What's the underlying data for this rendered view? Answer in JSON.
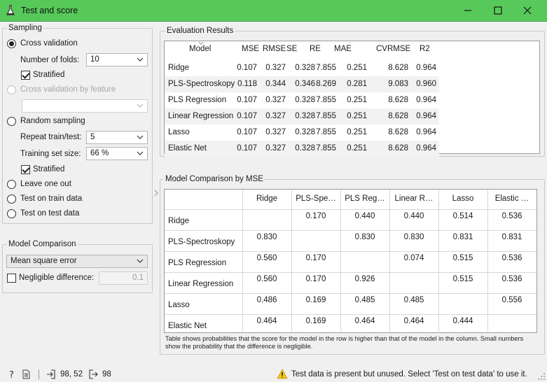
{
  "window": {
    "title": "Test and score"
  },
  "sampling": {
    "title": "Sampling",
    "cross_validation": "Cross validation",
    "folds_label": "Number of folds:",
    "folds_value": "10",
    "stratified": "Stratified",
    "cv_by_feature": "Cross validation by feature",
    "random_sampling": "Random sampling",
    "repeat_label": "Repeat train/test:",
    "repeat_value": "5",
    "train_size_label": "Training set size:",
    "train_size_value": "66 %",
    "stratified2": "Stratified",
    "leave_one_out": "Leave one out",
    "test_on_train": "Test on train data",
    "test_on_test": "Test on test data"
  },
  "model_comparison": {
    "title": "Model Comparison",
    "metric": "Mean square error",
    "negligible_label": "Negligible difference:",
    "negligible_value": "0.1"
  },
  "evaluation": {
    "title": "Evaluation Results",
    "headers": [
      "Model",
      "MSE",
      "RMSE",
      "SE",
      "RE",
      "MAE",
      "CVRMSE",
      "R2"
    ],
    "rows": [
      [
        "Ridge",
        "0.107",
        "0.327",
        "0.328",
        "7.855",
        "0.251",
        "8.628",
        "0.964"
      ],
      [
        "PLS-Spectroskopy",
        "0.118",
        "0.344",
        "0.346",
        "8.269",
        "0.281",
        "9.083",
        "0.960"
      ],
      [
        "PLS Regression",
        "0.107",
        "0.327",
        "0.328",
        "7.855",
        "0.251",
        "8.628",
        "0.964"
      ],
      [
        "Linear Regression",
        "0.107",
        "0.327",
        "0.328",
        "7.855",
        "0.251",
        "8.628",
        "0.964"
      ],
      [
        "Lasso",
        "0.107",
        "0.327",
        "0.328",
        "7.855",
        "0.251",
        "8.628",
        "0.964"
      ],
      [
        "Elastic Net",
        "0.107",
        "0.327",
        "0.328",
        "7.855",
        "0.251",
        "8.628",
        "0.964"
      ]
    ]
  },
  "comparison": {
    "title": "Model Comparison by MSE",
    "col_headers": [
      "Ridge",
      "PLS-Spe…",
      "PLS Reg…",
      "Linear R…",
      "Lasso",
      "Elastic …"
    ],
    "rows": [
      {
        "label": "Ridge",
        "values": [
          "",
          "0.170",
          "0.440",
          "0.440",
          "0.514",
          "0.536"
        ]
      },
      {
        "label": "PLS-Spectroskopy",
        "values": [
          "0.830",
          "",
          "0.830",
          "0.830",
          "0.831",
          "0.831"
        ]
      },
      {
        "label": "PLS Regression",
        "values": [
          "0.560",
          "0.170",
          "",
          "0.074",
          "0.515",
          "0.536"
        ]
      },
      {
        "label": "Linear Regression",
        "values": [
          "0.560",
          "0.170",
          "0.926",
          "",
          "0.515",
          "0.536"
        ]
      },
      {
        "label": "Lasso",
        "values": [
          "0.486",
          "0.169",
          "0.485",
          "0.485",
          "",
          "0.556"
        ]
      },
      {
        "label": "Elastic Net",
        "values": [
          "0.464",
          "0.169",
          "0.464",
          "0.464",
          "0.444",
          ""
        ]
      }
    ],
    "footnote_line1": "Table shows probabilities that the score for the model in the row is higher than that of the model in the column. Small numbers",
    "footnote_line2": "show the probability that the difference is negligible."
  },
  "status": {
    "input_count": "98, 52",
    "output_count": "98",
    "warning": "Test data is present but unused. Select 'Test on test data' to use it."
  },
  "colors": {
    "titlebar": "#57c95a",
    "row_alt": "#f2f2f2",
    "warning": "#f5c518"
  }
}
